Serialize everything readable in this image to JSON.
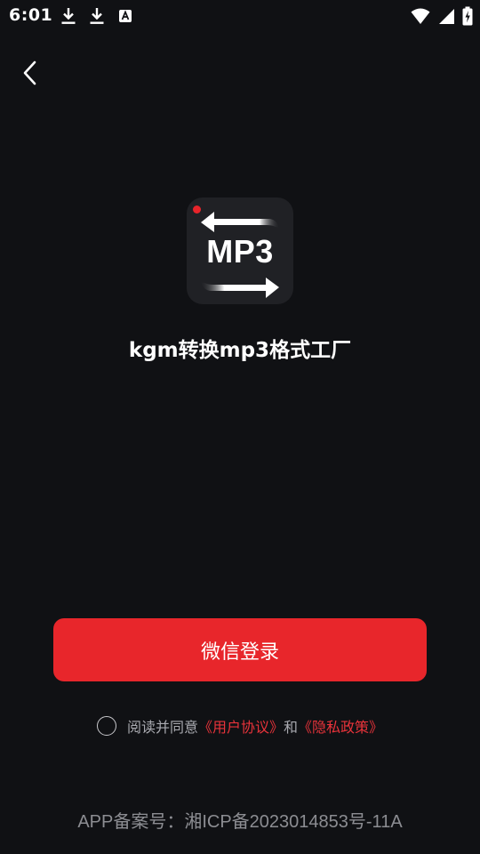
{
  "status_bar": {
    "time": "6:01",
    "left_icons": [
      "download-icon",
      "download-icon",
      "text-a-icon"
    ],
    "right_icons": [
      "wifi-icon",
      "cellular-signal-icon",
      "battery-charging-icon"
    ]
  },
  "header": {
    "back_icon": "chevron-left-icon"
  },
  "app": {
    "logo_text": "MP3",
    "name": "kgm转换mp3格式工厂"
  },
  "login": {
    "wechat_label": "微信登录"
  },
  "agreement": {
    "prefix": "阅读并同意",
    "user_agreement": "《用户协议》",
    "and": "和",
    "privacy_policy": "《隐私政策》"
  },
  "footer": {
    "icp": "APP备案号：湘ICP备2023014853号-11A"
  },
  "colors": {
    "background": "#101114",
    "accent": "#e8262b",
    "link": "#e8333a",
    "muted": "#a9aab0"
  }
}
